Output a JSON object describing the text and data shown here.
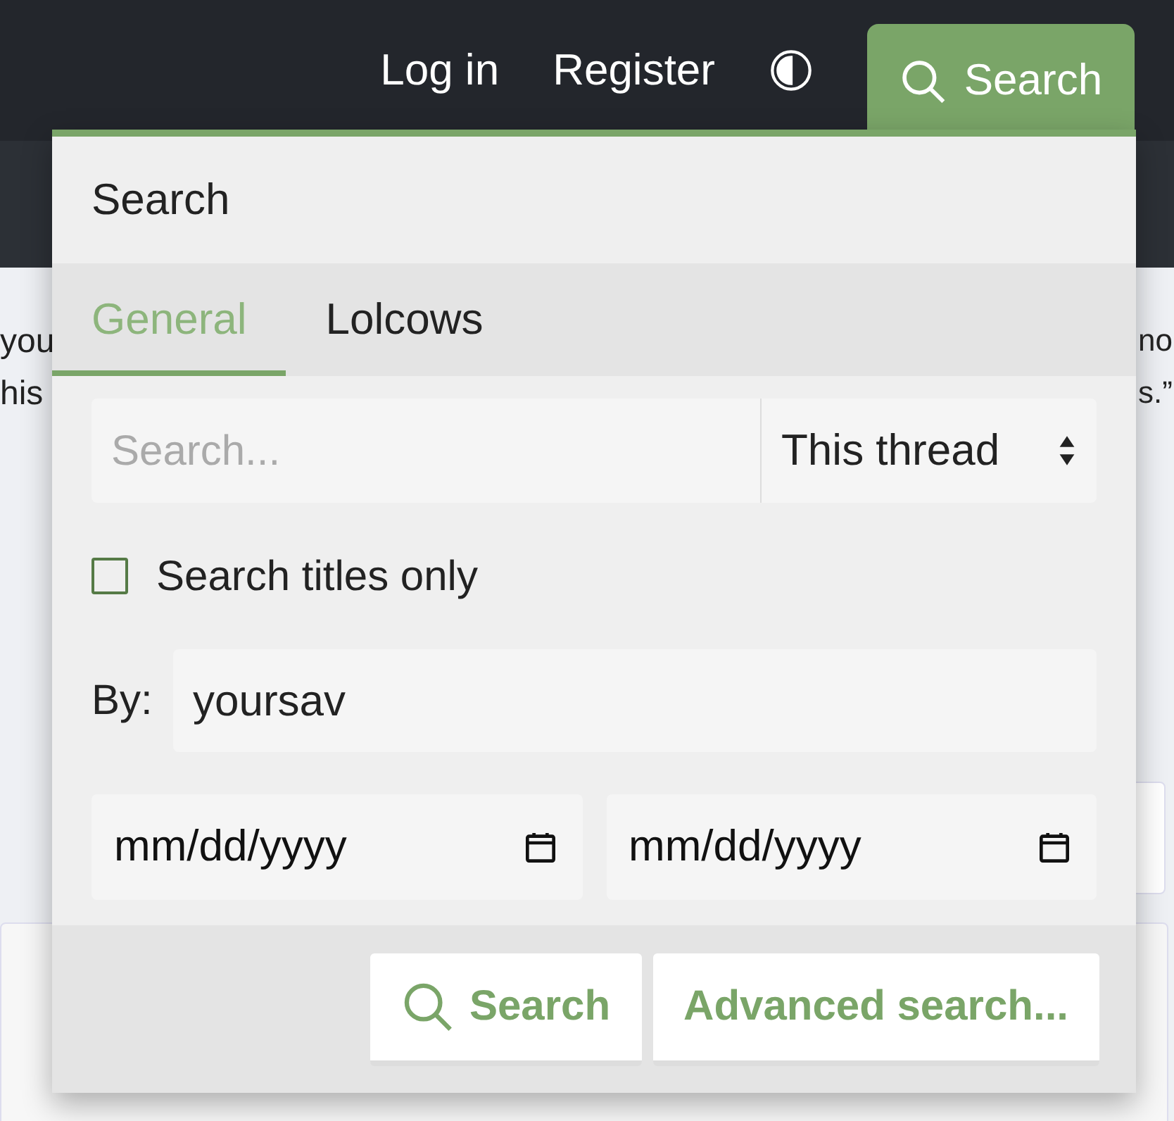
{
  "nav": {
    "links": [
      "Log in",
      "Register"
    ],
    "search_button": "Search"
  },
  "background_text": [
    "you",
    "his",
    "no",
    "s.”"
  ],
  "search_menu": {
    "title": "Search",
    "tabs": [
      {
        "label": "General",
        "selected": true
      },
      {
        "label": "Lolcows",
        "selected": false
      }
    ],
    "query": {
      "placeholder": "Search..."
    },
    "scope": {
      "value": "This thread"
    },
    "titles_only": {
      "label": "Search titles only",
      "checked": false
    },
    "by": {
      "label": "By:",
      "value": "yoursav"
    },
    "dates": [
      {
        "placeholder": "mm/dd/yyyy"
      },
      {
        "placeholder": "mm/dd/yyyy"
      }
    ],
    "buttons": [
      "Search",
      "Advanced search..."
    ]
  }
}
